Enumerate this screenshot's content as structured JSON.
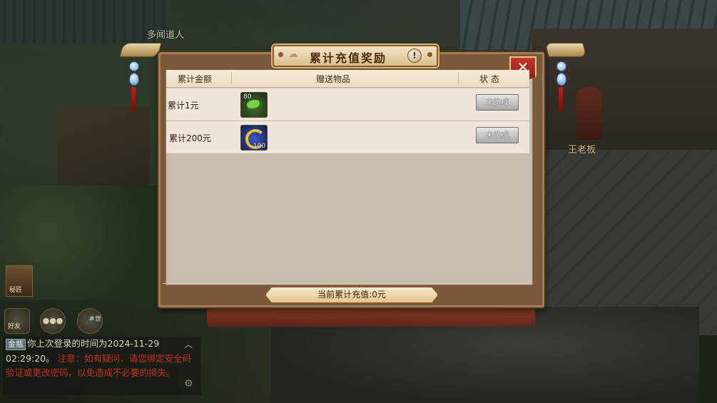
{
  "scene": {
    "npc_names": [
      "多闻道人",
      "王老板"
    ]
  },
  "hud": {
    "friend_label": "好友",
    "voice_label": "世",
    "mission_label": "秘匠"
  },
  "chat": {
    "tag": "金瓶",
    "line1": "你上次登录的时间为2024-11-29",
    "line2_time": "02:29:20。",
    "line2_warn": "注意：如有疑问，请您绑定安全码验证或更改密码，以免造成不必要的损失。"
  },
  "dialog": {
    "title": "累计充值奖励",
    "info_icon": "!",
    "close_icon": "✕",
    "columns": [
      "累计金额",
      "赠送物品",
      "状态"
    ],
    "rows": [
      {
        "amount": "累计1元",
        "item_level": "80",
        "item_count": "",
        "status": "未达成"
      },
      {
        "amount": "累计200元",
        "item_level": "",
        "item_count": "100",
        "status": "未达成"
      }
    ],
    "footer": "当前累计充值:0元"
  }
}
